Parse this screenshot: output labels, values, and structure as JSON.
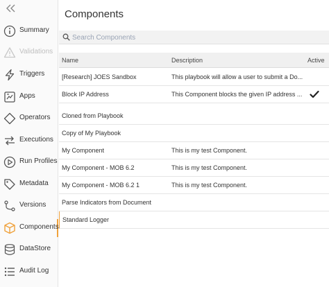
{
  "sidebar": {
    "items": [
      {
        "label": "Summary",
        "icon": "info-icon",
        "disabled": false,
        "active": false
      },
      {
        "label": "Validations",
        "icon": "warning-icon",
        "disabled": true,
        "active": false
      },
      {
        "label": "Triggers",
        "icon": "lightning-icon",
        "disabled": false,
        "active": false
      },
      {
        "label": "Apps",
        "icon": "apps-icon",
        "disabled": false,
        "active": false
      },
      {
        "label": "Operators",
        "icon": "diamond-icon",
        "disabled": false,
        "active": false
      },
      {
        "label": "Executions",
        "icon": "swap-arrows-icon",
        "disabled": false,
        "active": false
      },
      {
        "label": "Run Profiles",
        "icon": "play-circle-icon",
        "disabled": false,
        "active": false
      },
      {
        "label": "Metadata",
        "icon": "tag-icon",
        "disabled": false,
        "active": false
      },
      {
        "label": "Versions",
        "icon": "branch-icon",
        "disabled": false,
        "active": false
      },
      {
        "label": "Components",
        "icon": "cube-icon",
        "disabled": false,
        "active": true
      },
      {
        "label": "DataStore",
        "icon": "database-icon",
        "disabled": false,
        "active": false
      },
      {
        "label": "Audit Log",
        "icon": "list-icon",
        "disabled": false,
        "active": false
      }
    ]
  },
  "main": {
    "title": "Components",
    "search": {
      "placeholder": "Search Components",
      "value": ""
    },
    "table": {
      "headers": {
        "name": "Name",
        "description": "Description",
        "active": "Active"
      },
      "rows": [
        {
          "name": "[Research] JOES Sandbox",
          "description": "This playbook will allow a user to submit a Do...",
          "active": false
        },
        {
          "name": "Block IP Address",
          "description": "This Component blocks the given IP address ...",
          "active": true
        },
        {
          "name": "Cloned from Playbook",
          "description": "",
          "active": false
        },
        {
          "name": "Copy of My Playbook",
          "description": "",
          "active": false
        },
        {
          "name": "My Component",
          "description": "This is my test Component.",
          "active": false
        },
        {
          "name": "My Component - MOB 6.2",
          "description": "This is my test Component.",
          "active": false
        },
        {
          "name": "My Component - MOB 6.2 1",
          "description": "This is my test Component.",
          "active": false
        },
        {
          "name": "Parse Indicators from Document",
          "description": "",
          "active": false
        },
        {
          "name": "Standard Logger",
          "description": "",
          "active": false
        }
      ]
    }
  },
  "colors": {
    "accent": "#f0a13a",
    "icon": "#555555",
    "disabled": "#bfbfbf"
  }
}
